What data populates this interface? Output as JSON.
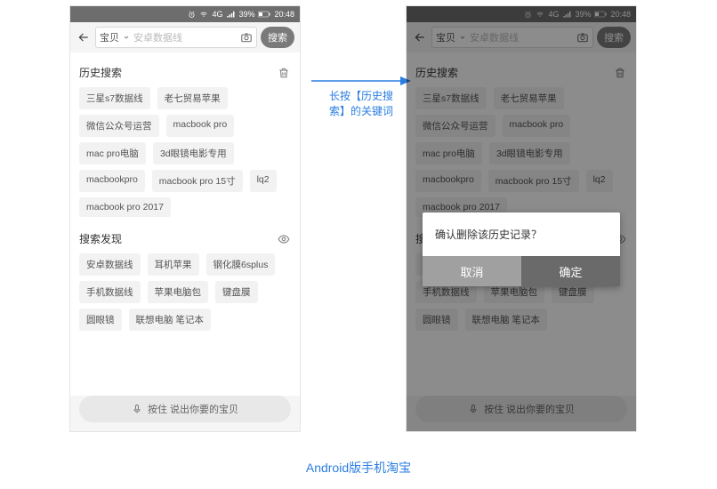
{
  "status": {
    "battery": "39%",
    "time": "20:48",
    "net": "4G"
  },
  "search": {
    "category": "宝贝",
    "placeholder": "安卓数据线",
    "button": "搜索"
  },
  "history": {
    "title": "历史搜索",
    "items": [
      "三星s7数据线",
      "老七贸易苹果",
      "微信公众号运营",
      "macbook pro",
      "mac pro电脑",
      "3d眼镜电影专用",
      "macbookpro",
      "macbook pro 15寸",
      "lq2",
      "macbook pro 2017"
    ]
  },
  "discover": {
    "title": "搜索发现",
    "items": [
      "安卓数据线",
      "耳机苹果",
      "钢化膜6splus",
      "手机数据线",
      "苹果电脑包",
      "键盘膜",
      "圆眼镜",
      "联想电脑 笔记本"
    ]
  },
  "voice": {
    "label": "按住 说出你要的宝贝"
  },
  "dialog": {
    "message": "确认删除该历史记录？",
    "cancel": "取消",
    "ok": "确定"
  },
  "annotation": {
    "text1": "长按【历史搜",
    "text2": "索】的关键词"
  },
  "caption": "Android版手机淘宝"
}
